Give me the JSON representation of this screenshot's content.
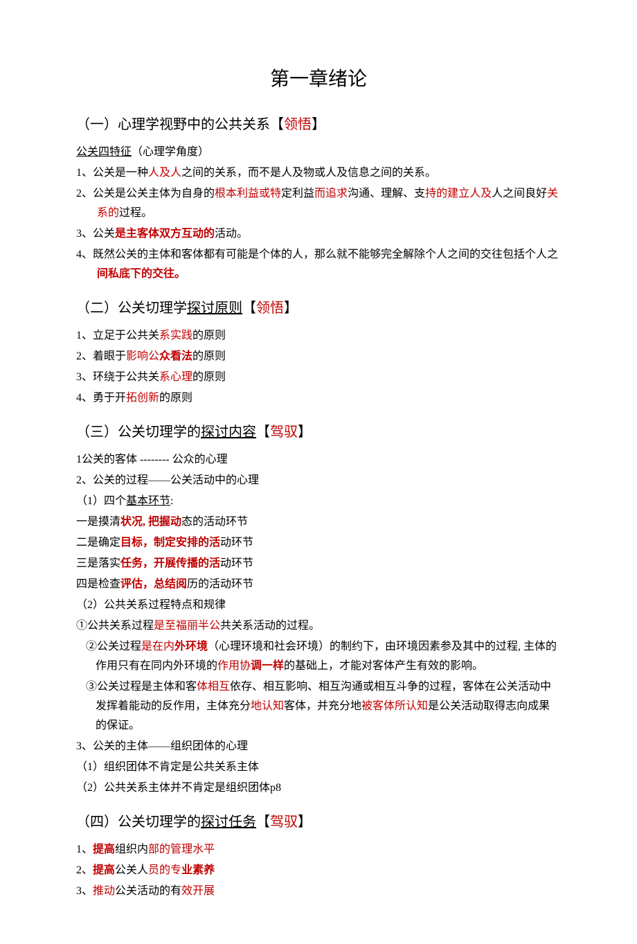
{
  "title": "第一章绪论",
  "s1": {
    "head_a": "（一）心理学视野中的公共关系【",
    "head_b": "领悟",
    "head_c": "】",
    "sub_a": "公关四特征",
    "sub_b": "（心理学角度）",
    "i1a": "1、公关是一种",
    "i1b": "人及人",
    "i1c": "之间的关系，而不是人及物或人及信息之间的关系。",
    "i2a": "2、公关是公关主体为自身的",
    "i2b": "根本利益或特",
    "i2c": "定利益",
    "i2d": "而追求",
    "i2e": "沟通、理解、支",
    "i2f": "持的建立人及",
    "i2g": "人之间良好",
    "i2h": "关系的",
    "i2i": "过程。",
    "i3a": "3、公关",
    "i3b": "是主客体双方互动的",
    "i3c": "活动。",
    "i4a": "4、既然公关的主体和客体都有可能是个体的人，那么就不能够完全解除个人之间的交往包括个人之",
    "i4b": "间私底下的交往。"
  },
  "s2": {
    "head_a": "（二）公关切理学",
    "head_u": "探讨原则",
    "head_b": "【",
    "head_c": "领悟",
    "head_d": "】",
    "i1a": "1、立足于公共关",
    "i1b": "系实践",
    "i1c": "的原则",
    "i2a": "2、着眼于",
    "i2b": "影响公",
    "i2c": "众看法",
    "i2d": "的原则",
    "i3a": "3、环绕于公共关",
    "i3b": "系心理",
    "i3c": "的原则",
    "i4a": "4、勇于开",
    "i4b": "拓创新",
    "i4c": "的原则"
  },
  "s3": {
    "head_a": "（三）公关切理学的",
    "head_u": "探讨内容",
    "head_b": "【",
    "head_c": "驾驭",
    "head_d": "】",
    "l1": "1公关的客体 -------- 公众的心理",
    "l2": "2、公关的过程——公关活动中的心理",
    "l3a": "（1）四个",
    "l3u": "基本环节",
    "l3b": ":",
    "e1a": "一是摸清",
    "e1b": "状况, 把握动",
    "e1c": "态的活动环节",
    "e2a": "二是确定",
    "e2b": "目标，制定安排的活",
    "e2c": "动环节",
    "e3a": "三是落实",
    "e3b": "任务，开展传播的活",
    "e3c": "动环节",
    "e4a": "四是检查",
    "e4b": "评估，总结阅",
    "e4c": "历的活动环节",
    "l4": "（2）公共关系过程特点和规律",
    "p1a": "①公共关系过程",
    "p1b": "是至福丽半公",
    "p1c": "共关系活动的过程。",
    "p2a": "②公关过程",
    "p2b": "是在内",
    "p2c": "外环境",
    "p2d": "（心理环境和社会环境）的制约下，由环境因素参及其中的过程, 主体的作用只有在同内外环境的",
    "p2e": "作用协",
    "p2f": "调一样",
    "p2g": "的基础上，才能对客体产生有效的影响。",
    "p3a": "③公关过程是主体和客",
    "p3b": "体相互",
    "p3c": "依存、相互影响、相互沟通或相互斗争的过程，客体在公关活动中发挥着能动的反作用，主体充分",
    "p3d": "地认知",
    "p3e": "客体，并充分地",
    "p3f": "被客体所认知",
    "p3g": "是公关活动取得志向成果的保证。",
    "l5": "3、公关的主体——组织团体的心理",
    "l6": "（1）组织团体不肯定是公共关系主体",
    "l7": "（2）公共关系主体并不肯定是组织团体p8"
  },
  "s4": {
    "head_a": "（四）公关切理学的",
    "head_u": "探讨任务",
    "head_b": "【",
    "head_c": "驾驭",
    "head_d": "】",
    "i1a": "1、",
    "i1b": "提高",
    "i1c": "组织内",
    "i1d": "部的管",
    "i1e": "理水平",
    "i2a": "2、",
    "i2b": "提高",
    "i2c": "公关人",
    "i2d": "员的专",
    "i2e": "业素养",
    "i3a": "3、",
    "i3b": "推动",
    "i3c": "公关活动的有",
    "i3d": "效开展"
  }
}
